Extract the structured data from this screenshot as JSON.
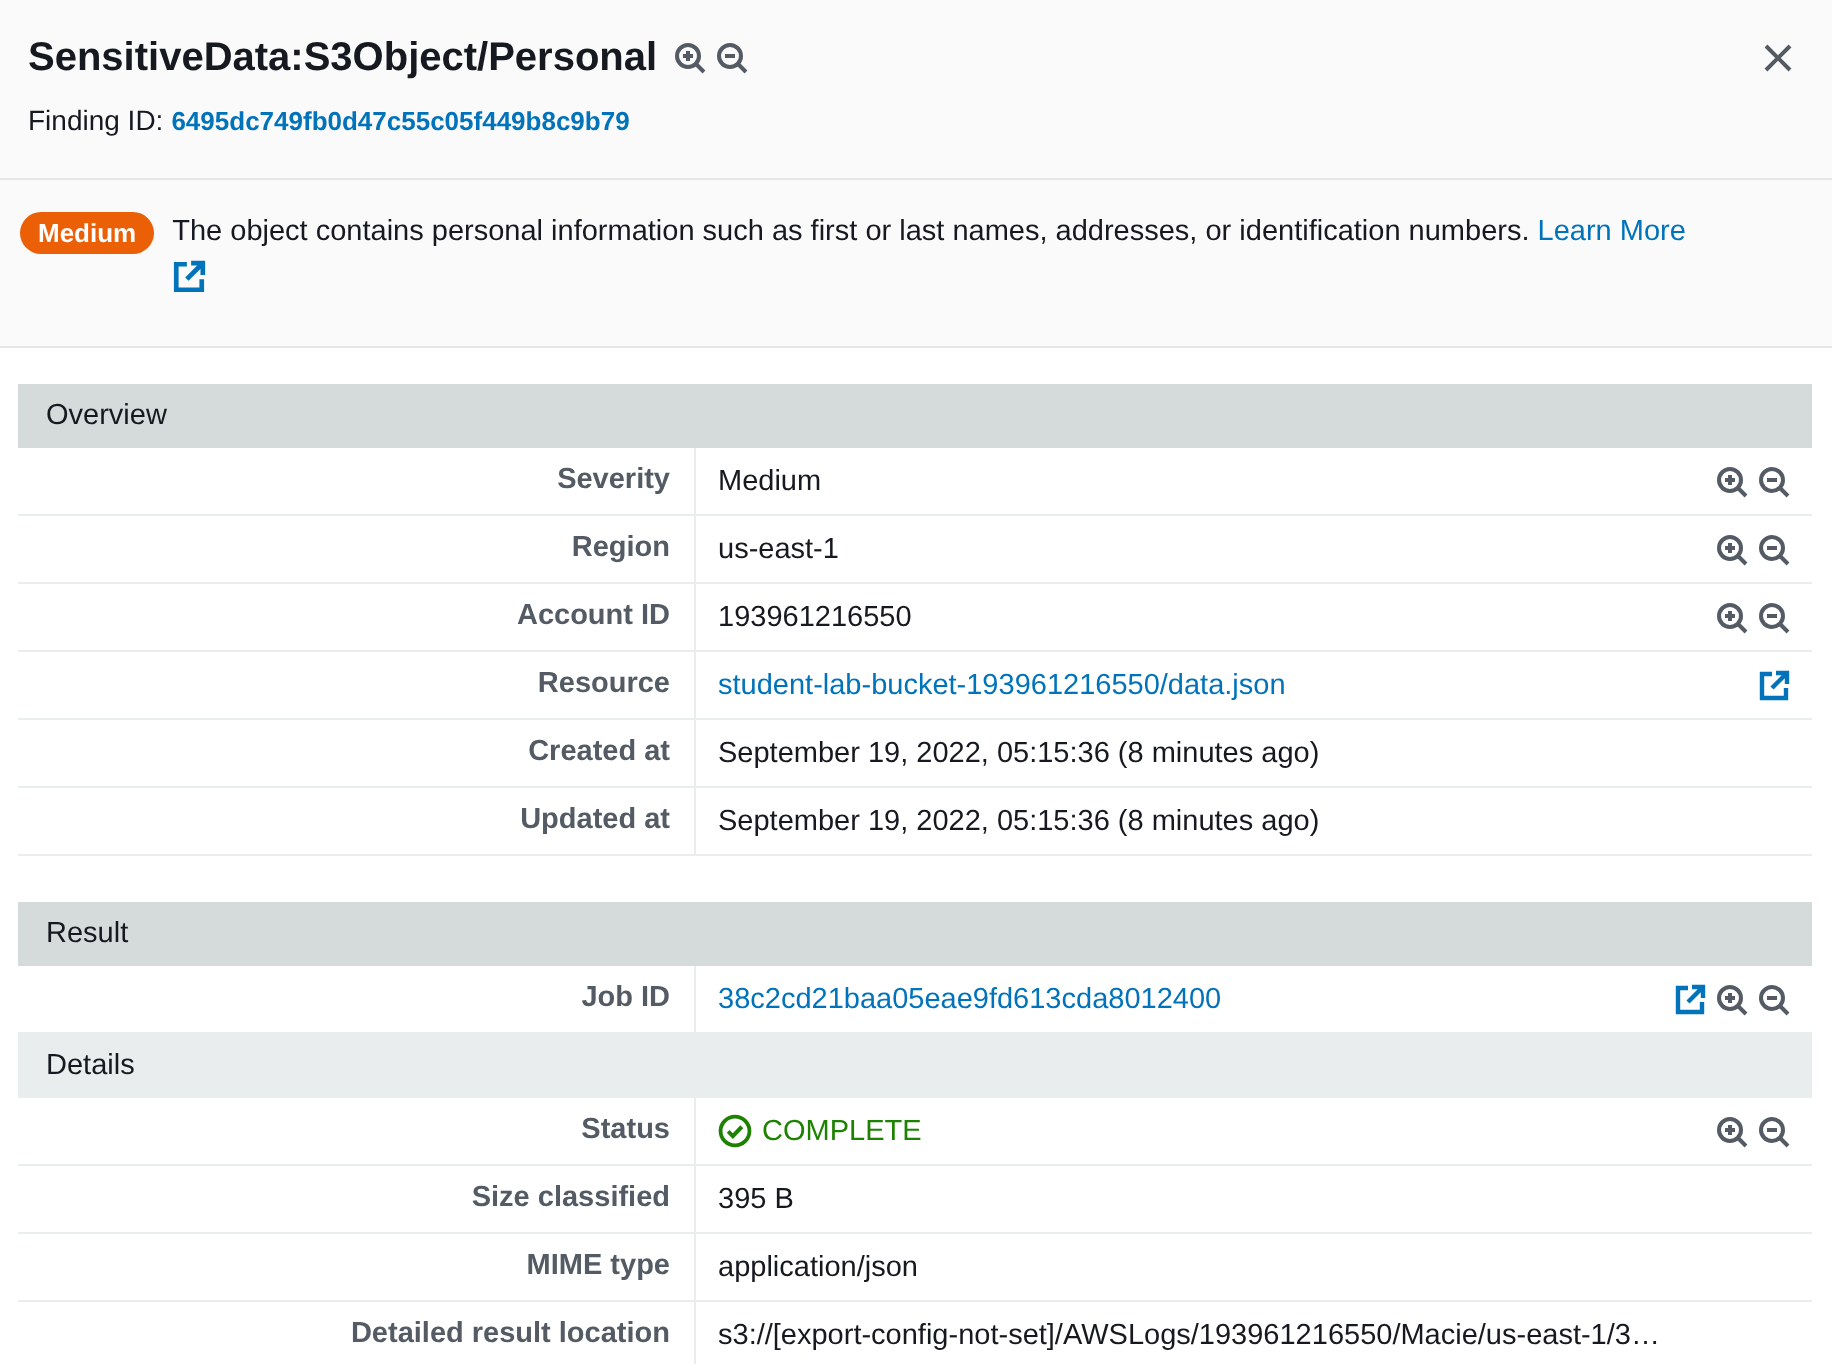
{
  "header": {
    "title": "SensitiveData:S3Object/Personal",
    "title_actions": [
      {
        "kind": "zoom-in"
      },
      {
        "kind": "zoom-out"
      }
    ],
    "finding_id_label": "Finding ID:",
    "finding_id": "6495dc749fb0d47c55c05f449b8c9b79"
  },
  "banner": {
    "badge": {
      "label": "Medium",
      "color": "#eb5f07"
    },
    "description": "The object contains personal information such as first or last names, addresses, or identification numbers.",
    "link": "Learn More"
  },
  "sections": [
    {
      "title": "Overview",
      "color": "#d5dbdb",
      "rows": [
        {
          "label": "Severity",
          "value": "Medium",
          "kind": "text",
          "actions": [
            {
              "kind": "zoom-in"
            },
            {
              "kind": "zoom-out"
            }
          ]
        },
        {
          "label": "Region",
          "value": "us-east-1",
          "kind": "text",
          "actions": [
            {
              "kind": "zoom-in"
            },
            {
              "kind": "zoom-out"
            }
          ]
        },
        {
          "label": "Account ID",
          "value": "193961216550",
          "kind": "text",
          "actions": [
            {
              "kind": "zoom-in"
            },
            {
              "kind": "zoom-out"
            }
          ]
        },
        {
          "label": "Resource",
          "value": "student-lab-bucket-193961216550/data.json",
          "kind": "link",
          "actions": [
            {
              "kind": "external"
            }
          ]
        },
        {
          "label": "Created at",
          "value": "September 19, 2022, 05:15:36 (8 minutes ago)",
          "kind": "text"
        },
        {
          "label": "Updated at",
          "value": "September 19, 2022, 05:15:36 (8 minutes ago)",
          "kind": "text"
        }
      ]
    },
    {
      "title": "Result",
      "color": "#d5dbdb",
      "rows": [
        {
          "label": "Job ID",
          "value": "38c2cd21baa05eae9fd613cda8012400",
          "kind": "link",
          "actions": [
            {
              "kind": "external"
            },
            {
              "kind": "zoom-in"
            },
            {
              "kind": "zoom-out"
            }
          ]
        }
      ]
    },
    {
      "title": "Details",
      "color": "#eaeded",
      "rows": [
        {
          "label": "Status",
          "value": "COMPLETE",
          "kind": "status",
          "actions": [
            {
              "kind": "zoom-in"
            },
            {
              "kind": "zoom-out"
            }
          ]
        },
        {
          "label": "Size classified",
          "value": "395 B",
          "kind": "text"
        },
        {
          "label": "MIME type",
          "value": "application/json",
          "kind": "text"
        },
        {
          "label": "Detailed result location",
          "value": "s3://[export-config-not-set]/AWSLogs/193961216550/Macie/us-east-1/3…",
          "kind": "text"
        }
      ]
    }
  ]
}
